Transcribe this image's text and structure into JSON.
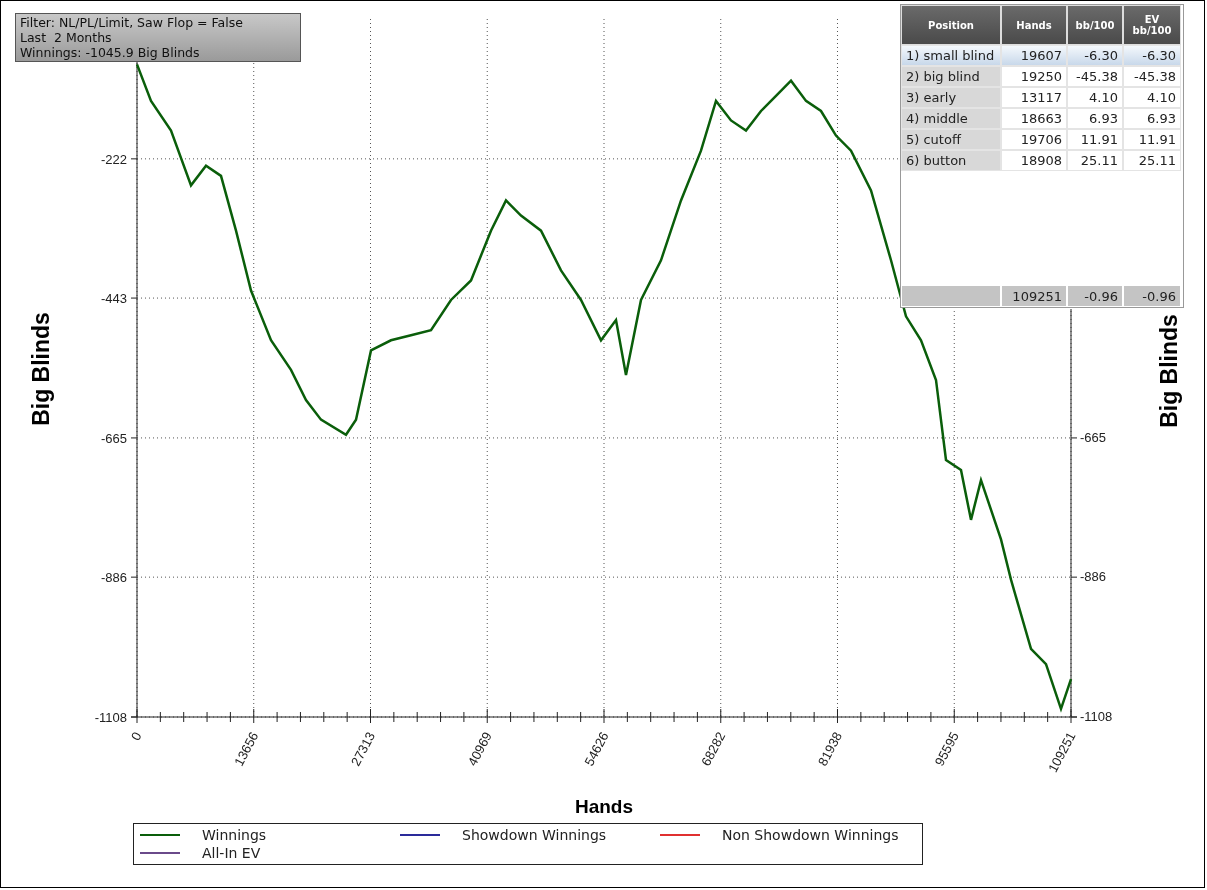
{
  "filter_box": {
    "lines": [
      "Filter: NL/PL/Limit, Saw Flop = False",
      "Last  2 Months",
      "Winnings: -1045.9 Big Blinds"
    ]
  },
  "chart_data": {
    "type": "line",
    "xlabel": "Hands",
    "ylabel": "Big Blinds",
    "xlim": [
      0,
      109251
    ],
    "ylim": [
      -1108,
      0
    ],
    "grid": true,
    "xticks": [
      0,
      13656,
      27313,
      40969,
      54626,
      68282,
      81938,
      95595,
      109251
    ],
    "yticks": [
      {
        "value": -222,
        "label": "-222"
      },
      {
        "value": -443,
        "label": "-443"
      },
      {
        "value": -665,
        "label": "-665"
      },
      {
        "value": -886,
        "label": "-886"
      },
      {
        "value": -1108,
        "label": "-1108"
      }
    ],
    "x": [
      0,
      1638,
      3977,
      6316,
      8071,
      9825,
      11580,
      13334,
      15674,
      18013,
      19768,
      21522,
      24447,
      25616,
      27371,
      29710,
      32049,
      34389,
      36728,
      39068,
      41407,
      43162,
      44916,
      47256,
      49595,
      51935,
      54274,
      56029,
      57198,
      58953,
      61292,
      63632,
      65971,
      67726,
      69480,
      71235,
      72990,
      74744,
      76499,
      78253,
      80008,
      81762,
      83517,
      85856,
      88196,
      89950,
      91705,
      93459,
      94629,
      96383,
      97553,
      98723,
      101062,
      102232,
      104571,
      106326,
      108080,
      109251
    ],
    "series": [
      {
        "name": "Winnings",
        "color": "#0a5e0a",
        "values": [
          -72,
          -130,
          -177,
          -264,
          -233,
          -249,
          -336,
          -431,
          -510,
          -557,
          -605,
          -636,
          -660,
          -636,
          -526,
          -510,
          -502,
          -494,
          -446,
          -415,
          -336,
          -288,
          -312,
          -336,
          -399,
          -446,
          -510,
          -478,
          -565,
          -446,
          -383,
          -288,
          -209,
          -130,
          -161,
          -177,
          -146,
          -122,
          -98,
          -130,
          -146,
          -185,
          -209,
          -272,
          -383,
          -472,
          -510,
          -573,
          -700,
          -716,
          -795,
          -732,
          -826,
          -890,
          -1000,
          -1024,
          -1095,
          -1048
        ]
      }
    ]
  },
  "right_axis": {
    "title": "Big Blinds",
    "tick_labels": [
      "-665",
      "-886",
      "-1108"
    ]
  },
  "table": {
    "columns": [
      "Position",
      "Hands",
      "bb/100",
      "EV bb/100"
    ],
    "rows": [
      {
        "cells": [
          "1) small blind",
          "19607",
          "-6.30",
          "-6.30"
        ],
        "selected": true
      },
      {
        "cells": [
          "2) big blind",
          "19250",
          "-45.38",
          "-45.38"
        ],
        "selected": false
      },
      {
        "cells": [
          "3) early",
          "13117",
          "4.10",
          "4.10"
        ],
        "selected": false
      },
      {
        "cells": [
          "4) middle",
          "18663",
          "6.93",
          "6.93"
        ],
        "selected": false
      },
      {
        "cells": [
          "5) cutoff",
          "19706",
          "11.91",
          "11.91"
        ],
        "selected": false
      },
      {
        "cells": [
          "6) button",
          "18908",
          "25.11",
          "25.11"
        ],
        "selected": false
      }
    ],
    "totals": [
      "109251",
      "-0.96",
      "-0.96"
    ]
  },
  "legend": [
    {
      "label": "Showdown Winnings",
      "color": "#2a2a9a"
    },
    {
      "label": "Non Showdown Winnings",
      "color": "#e03030"
    },
    {
      "label": "All-In EV",
      "color": "#6a4a8a"
    }
  ]
}
